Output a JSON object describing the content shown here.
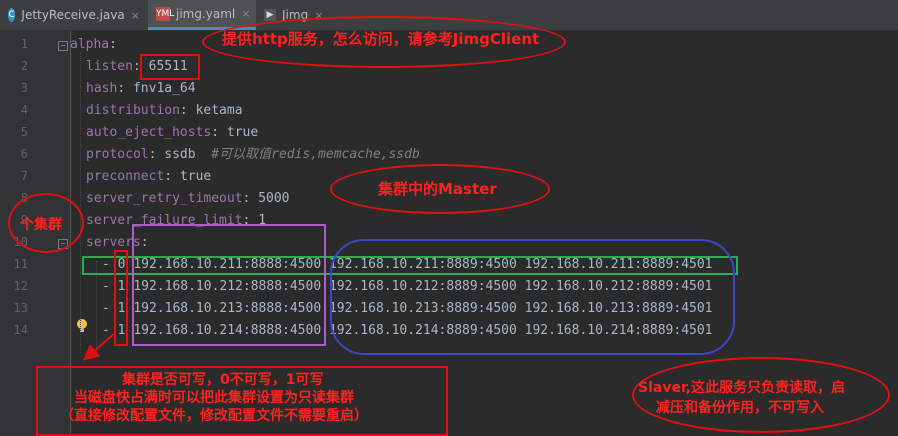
{
  "tabs": [
    {
      "label": "JettyReceive.java",
      "icon": "java-class-icon",
      "active": false
    },
    {
      "label": "jimg.yaml",
      "icon": "yaml-file-icon",
      "active": true
    },
    {
      "label": "Jimg",
      "icon": "run-config-icon",
      "active": false
    }
  ],
  "tab_close_glyph": "×",
  "line_numbers": [
    "1",
    "2",
    "3",
    "4",
    "5",
    "6",
    "7",
    "8",
    "9",
    "10",
    "11",
    "12",
    "13",
    "14"
  ],
  "code": {
    "l1_key": "alpha",
    "l2_key": "listen",
    "l2_val": "65511",
    "l3_key": "hash",
    "l3_val": "fnv1a_64",
    "l4_key": "distribution",
    "l4_val": "ketama",
    "l5_key": "auto_eject_hosts",
    "l5_val": "true",
    "l6_key": "protocol",
    "l6_val": "ssdb",
    "l6_comment": "#可以取值redis,memcache,ssdb",
    "l7_key": "preconnect",
    "l7_val": "true",
    "l8_key": "server_retry_timeout",
    "l8_val": "5000",
    "l9_key": "server_failure_limit",
    "l9_val": "1",
    "l10_key": "servers",
    "servers": [
      {
        "flag": "0",
        "master": "192.168.10.211:8888:4500",
        "slave1": "192.168.10.211:8889:4500",
        "slave2": "192.168.10.211:8889:4501"
      },
      {
        "flag": "1",
        "master": "192.168.10.212:8888:4500",
        "slave1": "192.168.10.212:8889:4500",
        "slave2": "192.168.10.212:8889:4501"
      },
      {
        "flag": "1",
        "master": "192.168.10.213:8888:4500",
        "slave1": "192.168.10.213:8889:4500",
        "slave2": "192.168.10.213:8889:4501"
      },
      {
        "flag": "1",
        "master": "192.168.10.214:8888:4500",
        "slave1": "192.168.10.214:8889:4500",
        "slave2": "192.168.10.214:8889:4501"
      }
    ]
  },
  "annotations": {
    "http_service": "提供http服务，怎么访问，请参考JimgClient",
    "cluster_master": "集群中的Master",
    "a_cluster": "个集群",
    "writable_l1": "集群是否可写，0不可写，1可写",
    "writable_l2": "当磁盘快占满时可以把此集群设置为只读集群",
    "writable_l3": "（直接修改配置文件，修改配置文件不需要重启）",
    "slaver_l1": "Slaver,这此服务只负责读取，启",
    "slaver_l2": "减压和备份作用，不可写入"
  },
  "colors": {
    "editor_bg": "#2b2b2b",
    "key": "#9876aa",
    "text": "#a9b7c6",
    "comment": "#808080",
    "annotation_red": "#ff2020",
    "master_box": "#b05cc8",
    "slave_box": "#3b46c9",
    "row_highlight": "#22b14c"
  }
}
